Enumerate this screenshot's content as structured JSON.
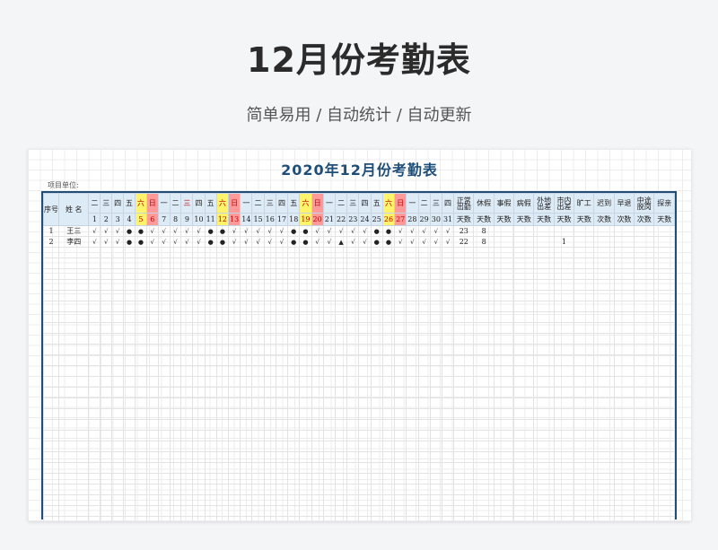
{
  "page": {
    "title": "12月份考勤表",
    "subtitle": "简单易用  /  自动统计  /  自动更新"
  },
  "sheet": {
    "title": "2020年12月份考勤表",
    "unit_label": "项目单位:",
    "headers": {
      "seq": "序号",
      "name": "姓 名",
      "weekdays": [
        "二",
        "三",
        "四",
        "五",
        "六",
        "日",
        "一",
        "二",
        "三",
        "四",
        "五",
        "六",
        "日",
        "一",
        "二",
        "三",
        "四",
        "五",
        "六",
        "日",
        "一",
        "二",
        "三",
        "四",
        "五",
        "六",
        "日",
        "一",
        "二",
        "三",
        "四"
      ],
      "days": [
        "1",
        "2",
        "3",
        "4",
        "5",
        "6",
        "7",
        "8",
        "9",
        "10",
        "11",
        "12",
        "13",
        "14",
        "15",
        "16",
        "17",
        "18",
        "19",
        "20",
        "21",
        "22",
        "23",
        "24",
        "25",
        "26",
        "27",
        "28",
        "29",
        "30",
        "31"
      ],
      "stats": [
        "正常出勤",
        "休假",
        "事假",
        "病假",
        "外地出差",
        "市内出差",
        "旷工",
        "迟到",
        "早退",
        "中途脱岗",
        "探亲"
      ],
      "stat_units": [
        "天数",
        "天数",
        "天数",
        "天数",
        "天数",
        "天数",
        "天数",
        "次数",
        "次数",
        "次数",
        "天数"
      ]
    },
    "rows": [
      {
        "seq": "1",
        "name": "王三",
        "marks": [
          "√",
          "√",
          "√",
          "●",
          "●",
          "√",
          "√",
          "√",
          "√",
          "√",
          "●",
          "●",
          "√",
          "√",
          "√",
          "√",
          "√",
          "●",
          "●",
          "√",
          "√",
          "√",
          "√",
          "√",
          "●",
          "●",
          "√",
          "√",
          "√",
          "√",
          "√"
        ],
        "stats": [
          "23",
          "8",
          "",
          "",
          "",
          "",
          "",
          "",
          "",
          "",
          ""
        ]
      },
      {
        "seq": "2",
        "name": "李四",
        "marks": [
          "√",
          "√",
          "√",
          "●",
          "●",
          "√",
          "√",
          "√",
          "√",
          "√",
          "●",
          "●",
          "√",
          "√",
          "√",
          "√",
          "√",
          "●",
          "●",
          "√",
          "√",
          "▲",
          "√",
          "√",
          "●",
          "●",
          "√",
          "√",
          "√",
          "√",
          "√"
        ],
        "stats": [
          "22",
          "8",
          "",
          "",
          "",
          "1",
          "",
          "",
          "",
          "",
          ""
        ]
      }
    ],
    "empty_rows": 27
  },
  "colors": {
    "accent": "#1f4e79",
    "header_bg": "#ddebf7",
    "saturday": "#fff36b",
    "sunday": "#ff9a9a",
    "weekend_text": "#c00000"
  }
}
